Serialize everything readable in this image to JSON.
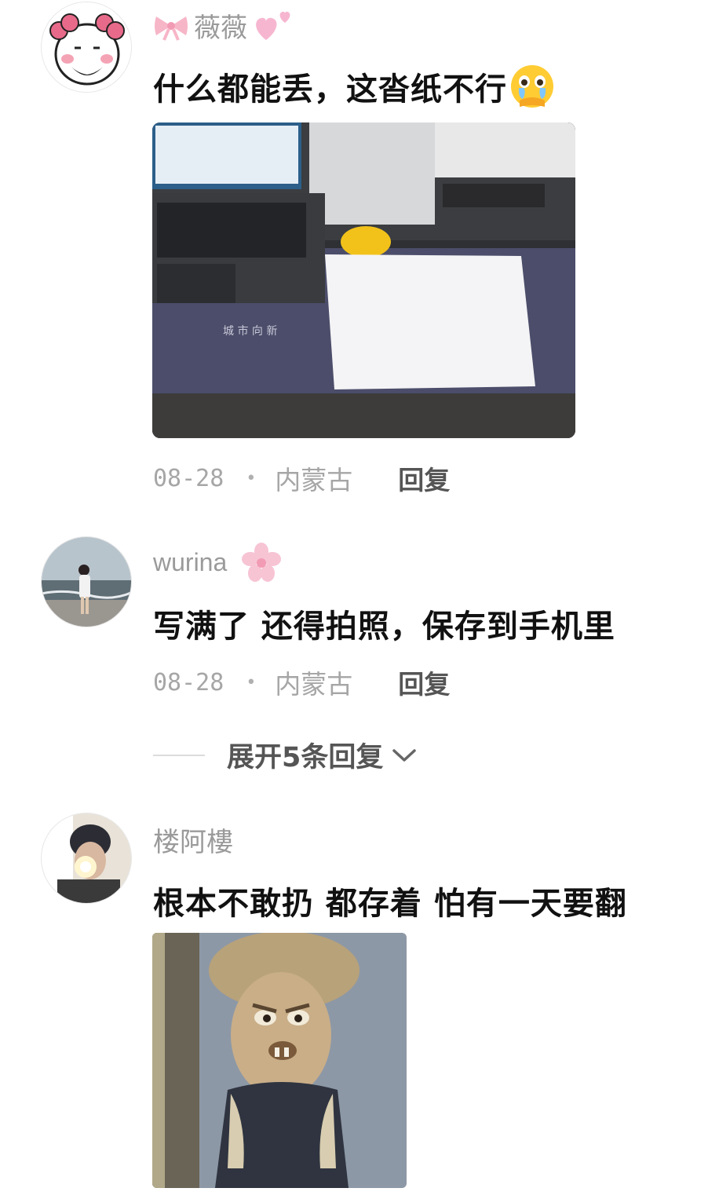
{
  "comments": [
    {
      "username": "薇薇",
      "text": "什么都能丢，这沓纸不行",
      "date": "08-28",
      "separator": "•",
      "location": "内蒙古",
      "reply_label": "回复",
      "name_icons": [
        "bow-icon",
        "hearts-icon"
      ],
      "text_emoji": "crying-face-icon",
      "image_description_icon": "laptop-desk-photo"
    },
    {
      "username": "wurina",
      "text": "写满了 还得拍照，保存到手机里",
      "date": "08-28",
      "separator": "•",
      "location": "内蒙古",
      "reply_label": "回复",
      "name_icons": [
        "flower-icon"
      ]
    },
    {
      "username": "楼阿樓",
      "text": "根本不敢扔 都存着 怕有一天要翻",
      "image_description_icon": "cartoon-meme-image"
    }
  ],
  "expand_replies": {
    "label": "展开5条回复",
    "icon": "chevron-down-icon"
  },
  "colors": {
    "username": "#9a9a9a",
    "content": "#111111",
    "meta": "#a6a6a6",
    "reply": "#555555"
  }
}
